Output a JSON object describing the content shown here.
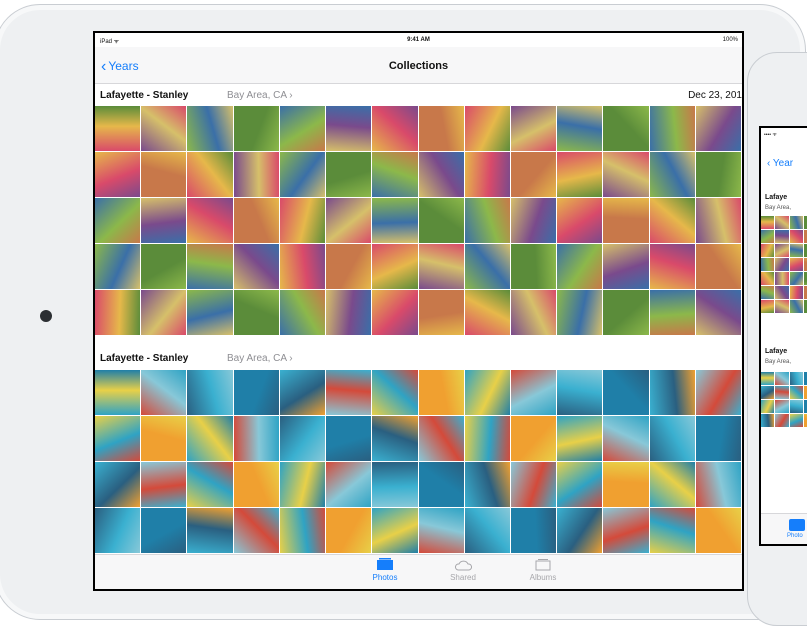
{
  "ipad": {
    "status": {
      "carrier": "iPad ᯤ",
      "time": "9:41 AM",
      "battery": "100%"
    },
    "nav": {
      "back_label": "Years",
      "title": "Collections"
    },
    "sections": [
      {
        "title": "Lafayette - Stanley",
        "location": "Bay Area, CA ›",
        "date": "Dec 23, 201"
      },
      {
        "title": "Lafayette - Stanley",
        "location": "Bay Area, CA ›"
      }
    ],
    "tabs": [
      {
        "label": "Photos",
        "icon": "photos-icon",
        "selected": true
      },
      {
        "label": "Shared",
        "icon": "cloud-icon",
        "selected": false
      },
      {
        "label": "Albums",
        "icon": "albums-icon",
        "selected": false
      }
    ]
  },
  "iphone": {
    "status": "•••• ᯤ",
    "back_label": "‹ Year",
    "sections": [
      {
        "title": "Lafaye",
        "location": "Bay Area,"
      },
      {
        "title": "Lafaye",
        "location": "Bay Area,"
      }
    ],
    "tab_label": "Photo"
  },
  "colors": {
    "accent": "#157efb",
    "party_palette": [
      "#d94a6a",
      "#5b8c3a",
      "#e6b84a",
      "#7a4a8c",
      "#3a6fa8",
      "#c8784a",
      "#8cb84a",
      "#d6c06a"
    ],
    "pool_palette": [
      "#2fa3c4",
      "#1f7fa8",
      "#e8d048",
      "#d44a3a",
      "#3ab0d0",
      "#f0a030",
      "#2a5f80",
      "#88c8d8"
    ]
  }
}
